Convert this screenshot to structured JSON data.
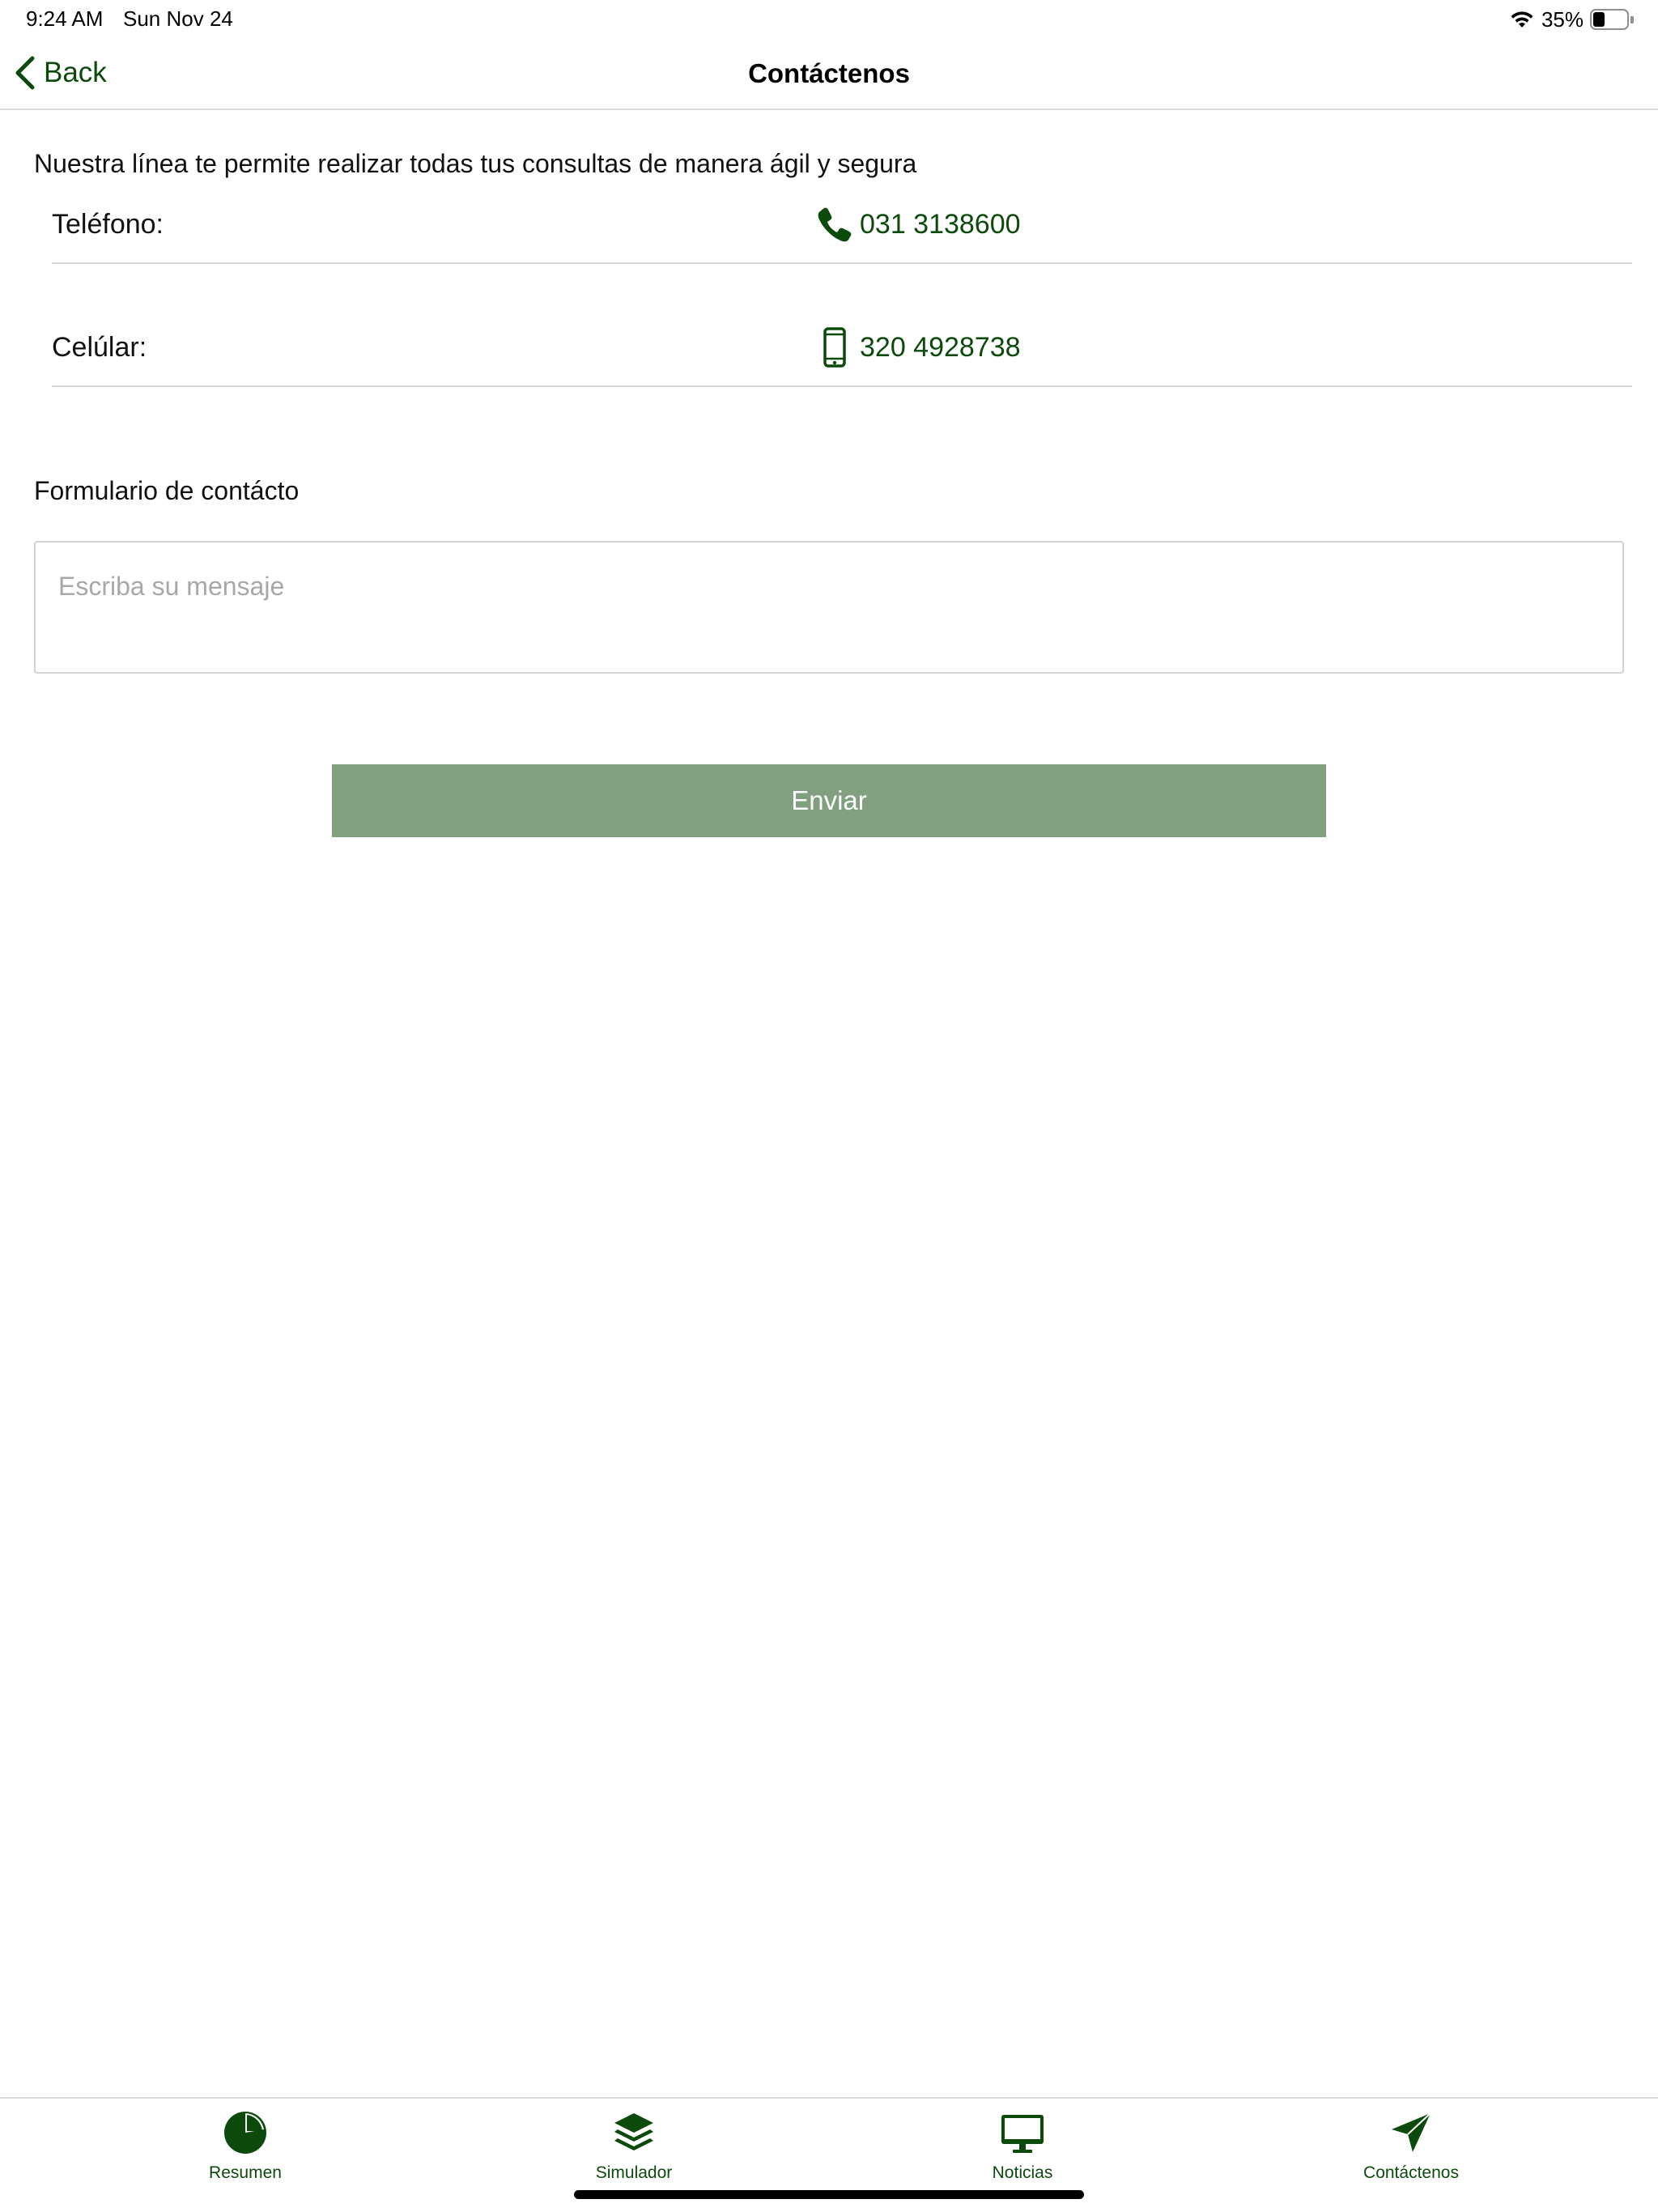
{
  "status_bar": {
    "time": "9:24 AM",
    "date": "Sun Nov 24",
    "battery": "35%",
    "battery_level": 0.35,
    "icons": [
      "wifi-icon",
      "battery-icon"
    ]
  },
  "nav": {
    "back_label": "Back",
    "title": "Contáctenos"
  },
  "intro": "Nuestra línea te permite realizar todas tus consultas de manera ágil y segura",
  "contacts": [
    {
      "label": "Teléfono:",
      "value": "031 3138600",
      "icon": "phone-icon"
    },
    {
      "label": "Celúlar:",
      "value": "320 4928738",
      "icon": "mobile-phone-icon"
    }
  ],
  "form": {
    "title": "Formulario de contácto",
    "placeholder": "Escriba su mensaje",
    "value": "",
    "submit_label": "Enviar"
  },
  "tabs": [
    {
      "label": "Resumen",
      "icon": "pie-chart-icon"
    },
    {
      "label": "Simulador",
      "icon": "layers-icon"
    },
    {
      "label": "Noticias",
      "icon": "desktop-icon"
    },
    {
      "label": "Contáctenos",
      "icon": "paper-plane-icon"
    }
  ],
  "colors": {
    "accent": "#0c4a0c",
    "button": "#80a07f",
    "divider": "#d6d6d6"
  }
}
